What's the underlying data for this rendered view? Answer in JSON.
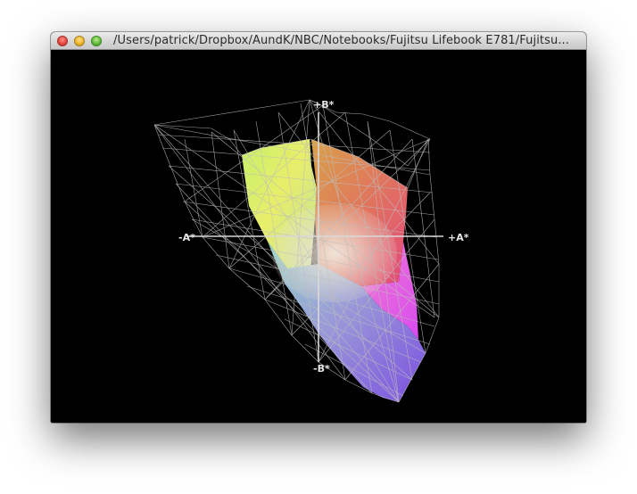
{
  "window": {
    "title": "/Users/patrick/Dropbox/AundK/NBC/Notebooks/Fujitsu Lifebook E781/Fujitsu...",
    "controls": {
      "close_icon": "close-icon",
      "minimize_icon": "minimize-icon",
      "maximize_icon": "zoom-icon"
    }
  },
  "gamut_plot": {
    "axes": {
      "b_plus": "+B*",
      "b_minus": "-B*",
      "a_plus": "+A*",
      "a_minus": "-A*"
    },
    "colors": {
      "background": "#000000",
      "wireframe": "#bdbdbd",
      "axis": "#d9d9d9"
    }
  }
}
